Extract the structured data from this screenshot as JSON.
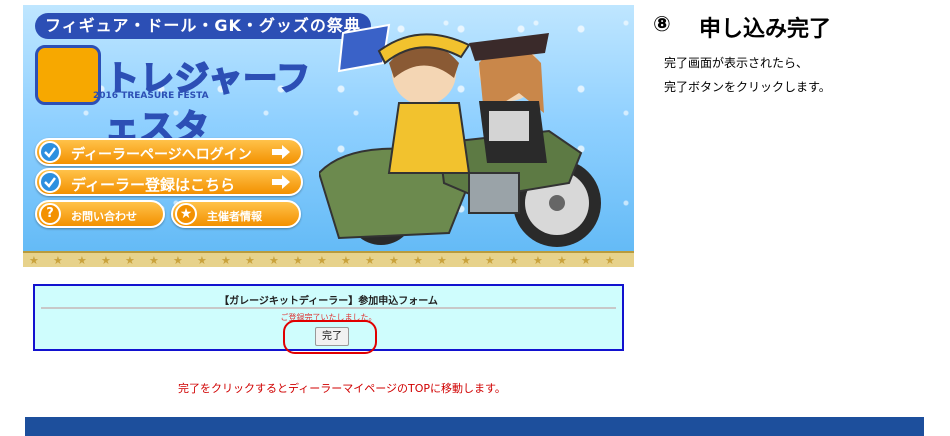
{
  "banner": {
    "tagline": "フィギュア・ドール・GK・グッズの祭典",
    "logo_text": "トレジャーフェスタ",
    "logo_year": "2016",
    "logo_sub": "TREASURE FESTA",
    "menu": [
      {
        "label": "ディーラーページへログイン",
        "icon": "check-icon"
      },
      {
        "label": "ディーラー登録はこちら",
        "icon": "check-icon"
      },
      {
        "label": "お問い合わせ",
        "icon": "question-icon"
      },
      {
        "label": "主催者情報",
        "icon": "star-icon"
      }
    ],
    "colors": {
      "primary": "#2c4fb5",
      "accent": "#f39100"
    }
  },
  "form": {
    "title": "【ガレージキットディーラー】参加申込フォーム",
    "message": "ご登録完了いたしました。",
    "button_label": "完了"
  },
  "note": "完了をクリックするとディーラーマイページのTOPに移動します。",
  "step": {
    "number": "⑧",
    "title": "申し込み完了",
    "line1": "完了画面が表示されたら、",
    "line2": "完了ボタンをクリックします。"
  },
  "colors": {
    "footer_bar": "#1d4f9c",
    "highlight": "#e00000",
    "form_border": "#1212cf",
    "form_bg": "#cffdfd"
  }
}
